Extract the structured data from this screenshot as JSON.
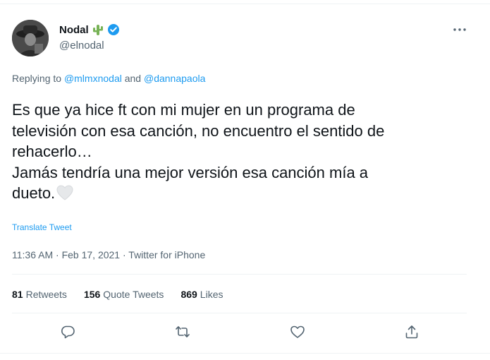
{
  "author": {
    "display_name": "Nodal",
    "handle": "@elnodal",
    "emoji_icon": "cactus-emoji",
    "verified_icon": "verified-badge-icon"
  },
  "reply_context": {
    "prefix": "Replying to ",
    "mention_1": "@mlmxnodal",
    "joiner": " and ",
    "mention_2": "@dannapaola"
  },
  "text": {
    "line_1": "Es que ya hice ft con mi mujer en un programa de",
    "line_2": "televisión con esa canción, no encuentro el sentido de",
    "line_3": "rehacerlo…",
    "line_4": "Jamás tendría una mejor versión esa canción mía a",
    "line_5": "dueto.",
    "emoji": "white-heart-emoji"
  },
  "translate_label": "Translate Tweet",
  "meta": {
    "time": "11:36 AM",
    "separator": " · ",
    "date": "Feb 17, 2021",
    "source": "Twitter for iPhone"
  },
  "stats": {
    "retweets_count": "81",
    "retweets_label": "Retweets",
    "quotes_count": "156",
    "quotes_label": "Quote Tweets",
    "likes_count": "869",
    "likes_label": "Likes"
  },
  "actions": [
    "reply-icon",
    "retweet-icon",
    "like-icon",
    "share-icon"
  ],
  "colors": {
    "accent": "#1d9bf0",
    "text_primary": "#0f1419",
    "text_secondary": "#536471",
    "divider": "#eff3f4"
  }
}
